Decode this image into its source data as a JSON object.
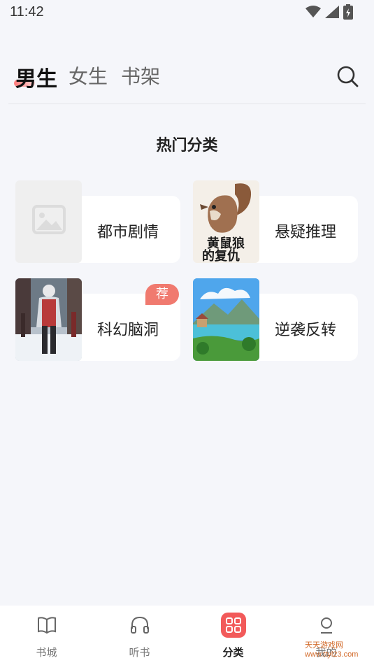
{
  "status": {
    "time": "11:42"
  },
  "tabs": [
    {
      "label": "男生"
    },
    {
      "label": "女生"
    },
    {
      "label": "书架"
    }
  ],
  "section_title": "热门分类",
  "categories": [
    {
      "label": "都市剧情",
      "badge": ""
    },
    {
      "label": "悬疑推理",
      "badge": ""
    },
    {
      "label": "科幻脑洞",
      "badge": "荐"
    },
    {
      "label": "逆袭反转",
      "badge": ""
    }
  ],
  "covers": {
    "book2_title": "黄鼠狼的复仇"
  },
  "bottom_nav": [
    {
      "label": "书城"
    },
    {
      "label": "听书"
    },
    {
      "label": "分类"
    },
    {
      "label": "我的"
    }
  ],
  "watermark": "天天游戏网 www.ttyl23.com",
  "colors": {
    "accent": "#f25a5a",
    "badge": "#f07a6f",
    "background": "#f5f6fa"
  }
}
